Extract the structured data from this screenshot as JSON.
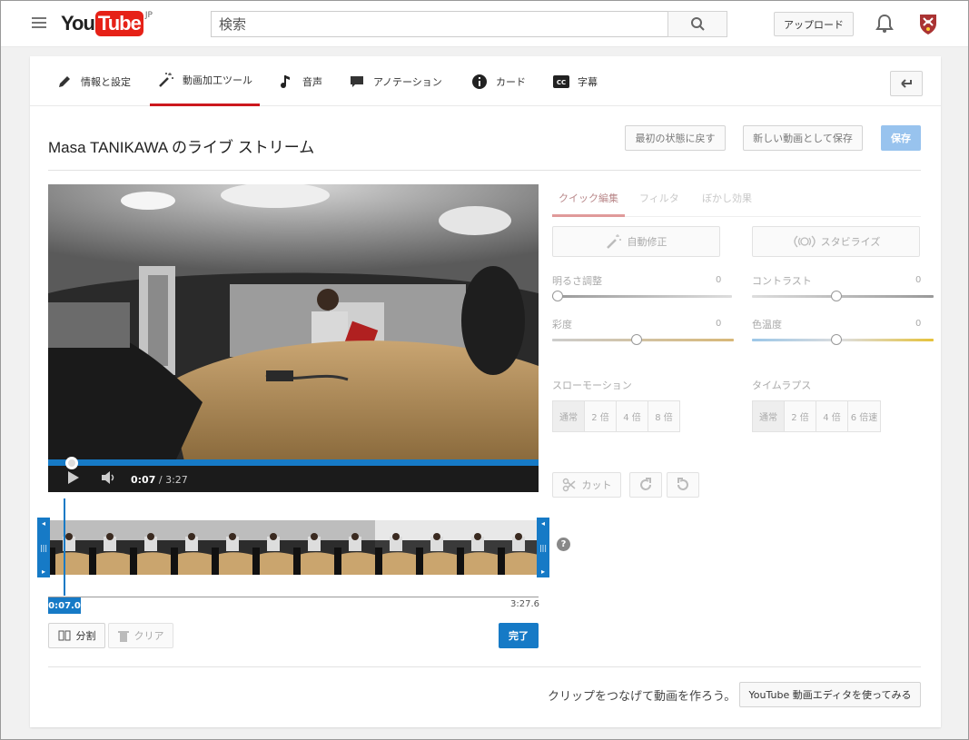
{
  "header": {
    "logo_you": "You",
    "logo_tube": "Tube",
    "logo_region": "JP",
    "search_placeholder": "検索",
    "upload_label": "アップロード"
  },
  "tabs": [
    {
      "label": "情報と設定",
      "icon": "pencil-icon"
    },
    {
      "label": "動画加工ツール",
      "icon": "magic-wand-icon",
      "active": true
    },
    {
      "label": "音声",
      "icon": "music-note-icon"
    },
    {
      "label": "アノテーション",
      "icon": "speech-bubble-icon"
    },
    {
      "label": "カード",
      "icon": "info-icon"
    },
    {
      "label": "字幕",
      "icon": "cc-icon"
    }
  ],
  "video_title": "Masa TANIKAWA のライブ ストリーム",
  "actions": {
    "revert": "最初の状態に戻す",
    "save_new": "新しい動画として保存",
    "save": "保存"
  },
  "player": {
    "current_time": "0:07",
    "duration": "3:27",
    "progress_fraction": 0.034
  },
  "trim": {
    "start_badge": "0:07.0",
    "end_time": "3:27.6",
    "split_label": "分割",
    "clear_label": "クリア",
    "done_label": "完了"
  },
  "panel": {
    "subtabs": [
      "クイック編集",
      "フィルタ",
      "ぼかし効果"
    ],
    "auto_fix": "自動修正",
    "stabilize": "スタビライズ",
    "brightness_label": "明るさ調整",
    "brightness_value": "0",
    "contrast_label": "コントラスト",
    "contrast_value": "0",
    "saturation_label": "彩度",
    "saturation_value": "0",
    "temperature_label": "色温度",
    "temperature_value": "0",
    "slowmo_label": "スローモーション",
    "slowmo_options": [
      "通常",
      "2 倍",
      "4 倍",
      "8 倍"
    ],
    "timelapse_label": "タイムラプス",
    "timelapse_options": [
      "通常",
      "2 倍",
      "4 倍",
      "6 倍速"
    ],
    "cut_label": "カット"
  },
  "footer": {
    "prompt": "クリップをつなげて動画を作ろう。",
    "editor_button": "YouTube 動画エディタを使ってみる"
  },
  "colors": {
    "brand_red": "#e62117",
    "accent_blue": "#167ac6",
    "save_disabled_blue": "#98c3ee"
  }
}
